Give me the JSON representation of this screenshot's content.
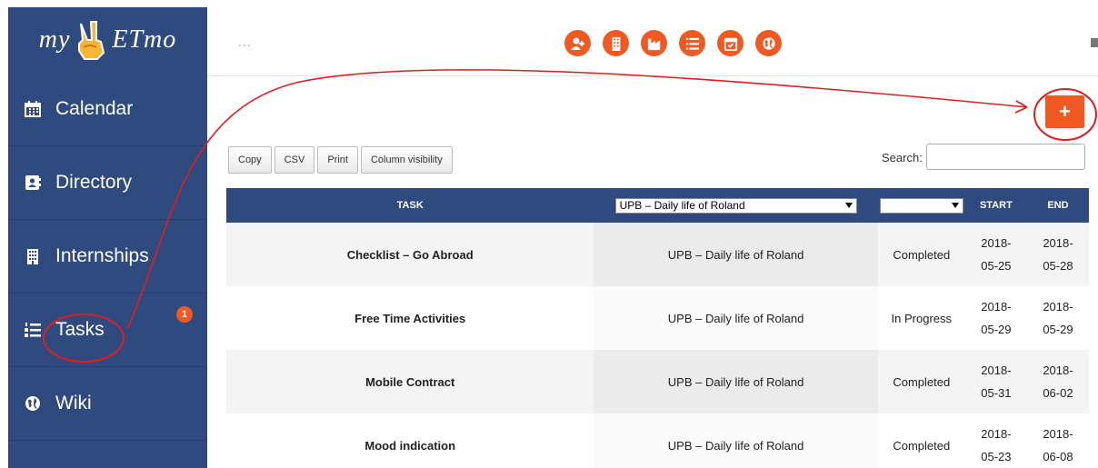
{
  "logo": {
    "prefix": "my",
    "suffix": "ETmo"
  },
  "sidebar": {
    "items": [
      {
        "label": "Calendar",
        "icon": "calendar-icon"
      },
      {
        "label": "Directory",
        "icon": "address-book-icon"
      },
      {
        "label": "Internships",
        "icon": "building-icon"
      },
      {
        "label": "Tasks",
        "icon": "list-numbered-icon",
        "badge": "1"
      },
      {
        "label": "Wiki",
        "icon": "globe-icon"
      }
    ]
  },
  "topbar": {
    "ellipsis": "...",
    "icons": [
      "add-user-icon",
      "building-icon",
      "industry-icon",
      "list-icon",
      "calendar-check-icon",
      "globe-icon"
    ]
  },
  "actions": {
    "add_label": "+"
  },
  "toolbar": {
    "copy": "Copy",
    "csv": "CSV",
    "print": "Print",
    "column_visibility": "Column visibility"
  },
  "search": {
    "label": "Search:",
    "value": ""
  },
  "table": {
    "headers": {
      "task": "TASK",
      "category_filter": "UPB – Daily life of Roland",
      "status_filter": "",
      "start": "START",
      "end": "END"
    },
    "rows": [
      {
        "task": "Checklist – Go Abroad",
        "category": "UPB – Daily life of Roland",
        "status": "Completed",
        "start_y": "2018-",
        "start_md": "05-25",
        "end_y": "2018-",
        "end_md": "05-28"
      },
      {
        "task": "Free Time Activities",
        "category": "UPB – Daily life of Roland",
        "status": "In Progress",
        "start_y": "2018-",
        "start_md": "05-29",
        "end_y": "2018-",
        "end_md": "05-29"
      },
      {
        "task": "Mobile Contract",
        "category": "UPB – Daily life of Roland",
        "status": "Completed",
        "start_y": "2018-",
        "start_md": "05-31",
        "end_y": "2018-",
        "end_md": "06-02"
      },
      {
        "task": "Mood indication",
        "category": "UPB – Daily life of Roland",
        "status": "Completed",
        "start_y": "2018-",
        "start_md": "05-23",
        "end_y": "2018-",
        "end_md": "06-08"
      }
    ]
  },
  "colors": {
    "sidebar": "#2f4a7f",
    "accent": "#f05a22",
    "annotation": "#e01e1e"
  }
}
